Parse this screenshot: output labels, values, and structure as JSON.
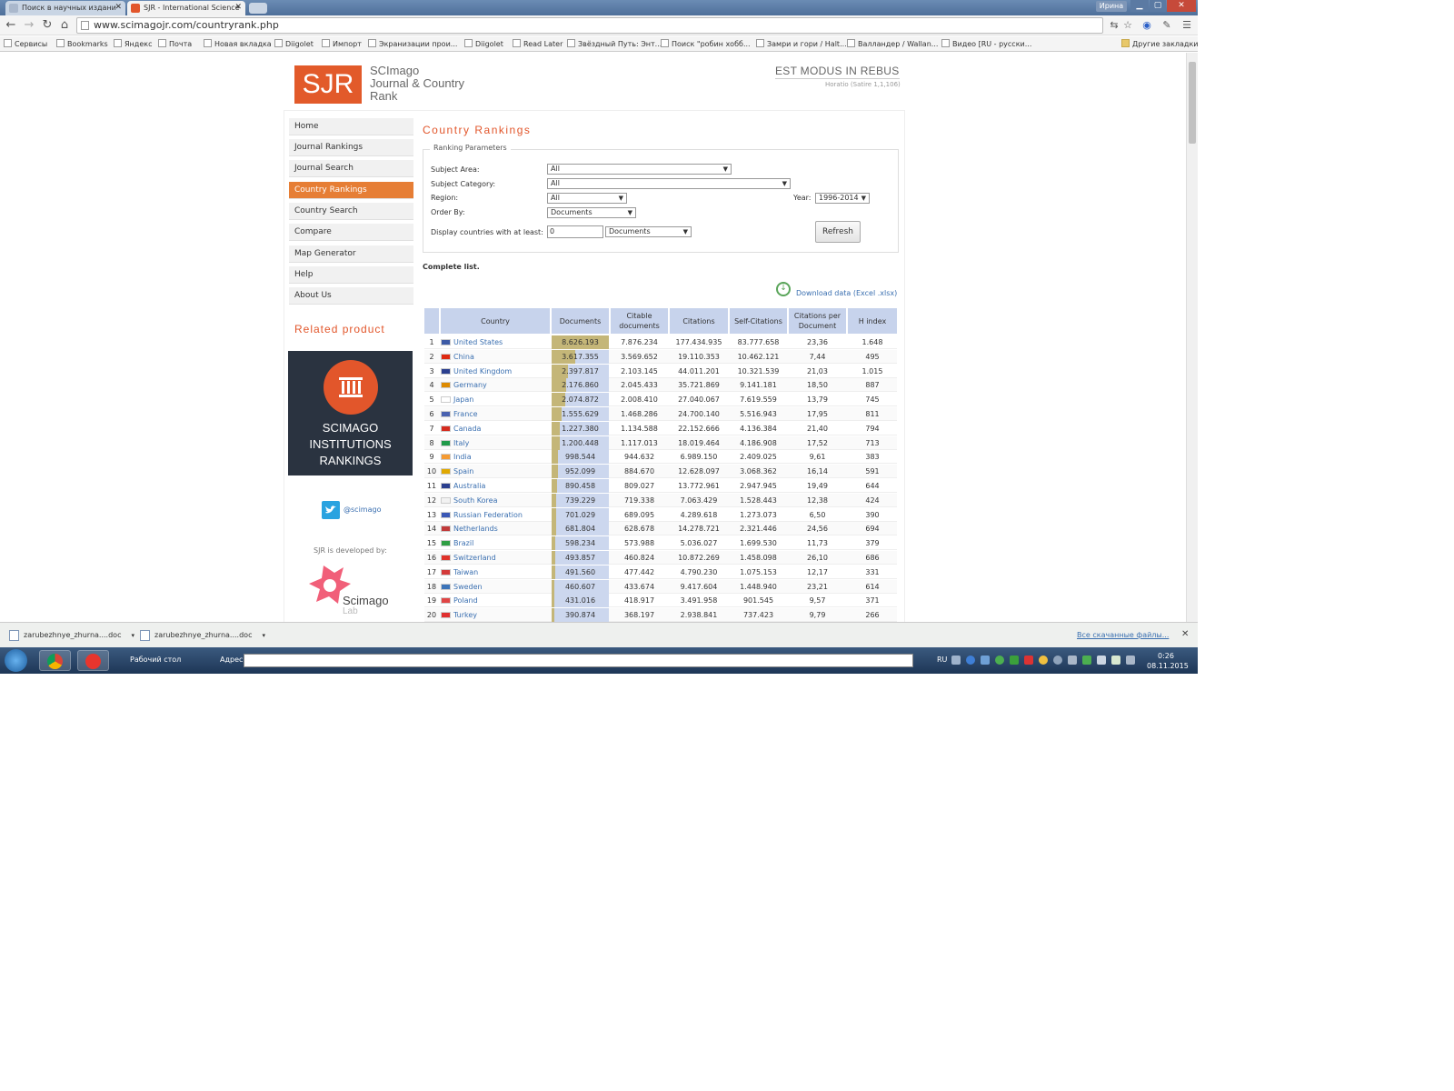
{
  "browser": {
    "tabs": [
      {
        "label": "Поиск в научных издани",
        "close": "✕"
      },
      {
        "label": "SJR - International Science",
        "close": "✕"
      }
    ],
    "user": "Ирина",
    "url": "www.scimagojr.com/countryrank.php",
    "bookmarks": [
      "Сервисы",
      "Bookmarks",
      "Яндекс",
      "Почта",
      "Новая вкладка",
      "Diigolet",
      "Импорт",
      "Экранизации прои...",
      "Diigolet",
      "Read Later",
      "Звёздный Путь: Энт...",
      "Поиск \"робин хобб...",
      "Замри и гори / Halt...",
      "Валландер / Wallan...",
      "Видео [RU - русски...",
      "Другие закладки"
    ]
  },
  "site": {
    "logo": "SJR",
    "logo_line1": "SCImago",
    "logo_line2": "Journal & Country",
    "logo_line3": "Rank",
    "motto": "EST MODUS IN REBUS",
    "motto_source": "Horatio (Satire 1,1,106)"
  },
  "menu": [
    "Home",
    "Journal Rankings",
    "Journal Search",
    "Country Rankings",
    "Country Search",
    "Compare",
    "Map Generator",
    "Help",
    "About Us"
  ],
  "sidebar": {
    "related_title": "Related product",
    "banner_line1": "SCIMAGO",
    "banner_line2": "INSTITUTIONS",
    "banner_line3": "RANKINGS",
    "twitter": "@scimago",
    "developed_by": "SJR is developed by:",
    "lab_name": "Scimago",
    "lab_sub": "Lab"
  },
  "main": {
    "title": "Country Rankings",
    "params_legend": "Ranking Parameters",
    "subject_area_label": "Subject Area:",
    "subject_area_value": "All",
    "subject_category_label": "Subject Category:",
    "subject_category_value": "All",
    "region_label": "Region:",
    "region_value": "All",
    "year_label": "Year:",
    "year_value": "1996-2014",
    "order_label": "Order By:",
    "order_value": "Documents",
    "display_label": "Display countries with at least:",
    "display_min": "0",
    "display_unit": "Documents",
    "refresh": "Refresh",
    "complete_list": "Complete list.",
    "download": "Download data (Excel .xlsx)"
  },
  "table": {
    "headers": [
      "Country",
      "Documents",
      "Citable documents",
      "Citations",
      "Self-Citations",
      "Citations per Document",
      "H index"
    ],
    "rows": [
      {
        "rank": "1",
        "country": "United States",
        "flag": "#3c5aa6",
        "documents": "8.626.193",
        "doc_share": 1.0,
        "citable": "7.876.234",
        "citations": "177.434.935",
        "self": "83.777.658",
        "cpd": "23,36",
        "h": "1.648"
      },
      {
        "rank": "2",
        "country": "China",
        "flag": "#de2910",
        "documents": "3.617.355",
        "doc_share": 0.42,
        "citable": "3.569.652",
        "citations": "19.110.353",
        "self": "10.462.121",
        "cpd": "7,44",
        "h": "495"
      },
      {
        "rank": "3",
        "country": "United Kingdom",
        "flag": "#2b3f8f",
        "documents": "2.397.817",
        "doc_share": 0.278,
        "citable": "2.103.145",
        "citations": "44.011.201",
        "self": "10.321.539",
        "cpd": "21,03",
        "h": "1.015"
      },
      {
        "rank": "4",
        "country": "Germany",
        "flag": "#dd8a00",
        "documents": "2.176.860",
        "doc_share": 0.252,
        "citable": "2.045.433",
        "citations": "35.721.869",
        "self": "9.141.181",
        "cpd": "18,50",
        "h": "887"
      },
      {
        "rank": "5",
        "country": "Japan",
        "flag": "#ffffff",
        "documents": "2.074.872",
        "doc_share": 0.24,
        "citable": "2.008.410",
        "citations": "27.040.067",
        "self": "7.619.559",
        "cpd": "13,79",
        "h": "745"
      },
      {
        "rank": "6",
        "country": "France",
        "flag": "#4a62b0",
        "documents": "1.555.629",
        "doc_share": 0.18,
        "citable": "1.468.286",
        "citations": "24.700.140",
        "self": "5.516.943",
        "cpd": "17,95",
        "h": "811"
      },
      {
        "rank": "7",
        "country": "Canada",
        "flag": "#d52b1e",
        "documents": "1.227.380",
        "doc_share": 0.142,
        "citable": "1.134.588",
        "citations": "22.152.666",
        "self": "4.136.384",
        "cpd": "21,40",
        "h": "794"
      },
      {
        "rank": "8",
        "country": "Italy",
        "flag": "#1f9a4a",
        "documents": "1.200.448",
        "doc_share": 0.139,
        "citable": "1.117.013",
        "citations": "18.019.464",
        "self": "4.186.908",
        "cpd": "17,52",
        "h": "713"
      },
      {
        "rank": "9",
        "country": "India",
        "flag": "#f59b33",
        "documents": "998.544",
        "doc_share": 0.116,
        "citable": "944.632",
        "citations": "6.989.150",
        "self": "2.409.025",
        "cpd": "9,61",
        "h": "383"
      },
      {
        "rank": "10",
        "country": "Spain",
        "flag": "#e0a800",
        "documents": "952.099",
        "doc_share": 0.11,
        "citable": "884.670",
        "citations": "12.628.097",
        "self": "3.068.362",
        "cpd": "16,14",
        "h": "591"
      },
      {
        "rank": "11",
        "country": "Australia",
        "flag": "#2b3f8f",
        "documents": "890.458",
        "doc_share": 0.103,
        "citable": "809.027",
        "citations": "13.772.961",
        "self": "2.947.945",
        "cpd": "19,49",
        "h": "644"
      },
      {
        "rank": "12",
        "country": "South Korea",
        "flag": "#f2f2f2",
        "documents": "739.229",
        "doc_share": 0.086,
        "citable": "719.338",
        "citations": "7.063.429",
        "self": "1.528.443",
        "cpd": "12,38",
        "h": "424"
      },
      {
        "rank": "13",
        "country": "Russian Federation",
        "flag": "#3a57b5",
        "documents": "701.029",
        "doc_share": 0.081,
        "citable": "689.095",
        "citations": "4.289.618",
        "self": "1.273.073",
        "cpd": "6,50",
        "h": "390"
      },
      {
        "rank": "14",
        "country": "Netherlands",
        "flag": "#c13a3a",
        "documents": "681.804",
        "doc_share": 0.079,
        "citable": "628.678",
        "citations": "14.278.721",
        "self": "2.321.446",
        "cpd": "24,56",
        "h": "694"
      },
      {
        "rank": "15",
        "country": "Brazil",
        "flag": "#2f9e44",
        "documents": "598.234",
        "doc_share": 0.069,
        "citable": "573.988",
        "citations": "5.036.027",
        "self": "1.699.530",
        "cpd": "11,73",
        "h": "379"
      },
      {
        "rank": "16",
        "country": "Switzerland",
        "flag": "#e0322a",
        "documents": "493.857",
        "doc_share": 0.057,
        "citable": "460.824",
        "citations": "10.872.269",
        "self": "1.458.098",
        "cpd": "26,10",
        "h": "686"
      },
      {
        "rank": "17",
        "country": "Taiwan",
        "flag": "#d43a3a",
        "documents": "491.560",
        "doc_share": 0.057,
        "citable": "477.442",
        "citations": "4.790.230",
        "self": "1.075.153",
        "cpd": "12,17",
        "h": "331"
      },
      {
        "rank": "18",
        "country": "Sweden",
        "flag": "#3b73b8",
        "documents": "460.607",
        "doc_share": 0.053,
        "citable": "433.674",
        "citations": "9.417.604",
        "self": "1.448.940",
        "cpd": "23,21",
        "h": "614"
      },
      {
        "rank": "19",
        "country": "Poland",
        "flag": "#e04545",
        "documents": "431.016",
        "doc_share": 0.05,
        "citable": "418.917",
        "citations": "3.491.958",
        "self": "901.545",
        "cpd": "9,57",
        "h": "371"
      },
      {
        "rank": "20",
        "country": "Turkey",
        "flag": "#e03030",
        "documents": "390.874",
        "doc_share": 0.045,
        "citable": "368.197",
        "citations": "2.938.841",
        "self": "737.423",
        "cpd": "9,79",
        "h": "266"
      }
    ]
  },
  "downloads": {
    "items": [
      "zarubezhnye_zhurna....doc",
      "zarubezhnye_zhurna....doc"
    ],
    "show_all": "Все скачанные файлы...",
    "close": "✕"
  },
  "taskbar": {
    "desktop": "Рабочий стол",
    "address_label": "Адрес",
    "lang": "RU",
    "time": "0:26",
    "date": "08.11.2015"
  },
  "colors": {
    "accent": "#e2562b",
    "menu_active": "#e67e35",
    "table_header": "#c7d3ec",
    "doc_bar": "#c4b678",
    "link": "#3a6fb0"
  }
}
